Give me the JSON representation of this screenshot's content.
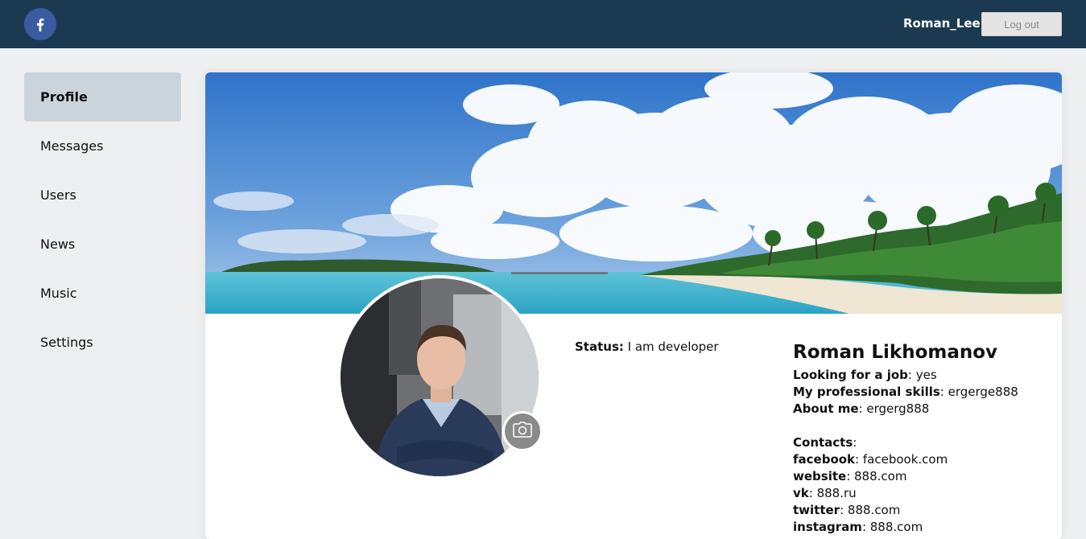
{
  "header": {
    "logo_icon": "facebook-icon",
    "username": "Roman_Lee",
    "logout_label": "Log out"
  },
  "sidebar": {
    "items": [
      {
        "label": "Profile",
        "active": true
      },
      {
        "label": "Messages",
        "active": false
      },
      {
        "label": "Users",
        "active": false
      },
      {
        "label": "News",
        "active": false
      },
      {
        "label": "Music",
        "active": false
      },
      {
        "label": "Settings",
        "active": false
      }
    ]
  },
  "profile": {
    "cover_image": "tropical-beach-cover",
    "avatar_image": "man-in-navy-suit",
    "camera_icon": "camera-icon",
    "status_label": "Status:",
    "status_value": "I am developer",
    "full_name": "Roman Likhomanov",
    "looking_for_job_label": "Looking for a job",
    "looking_for_job_value": ": yes",
    "skills_label": "My professional skills",
    "skills_value": ": ergerge888",
    "about_label": "About me",
    "about_value": ": ergerg888",
    "contacts_label": "Contacts",
    "contacts_colon": ":",
    "contacts": [
      {
        "label": "facebook",
        "value": ": facebook.com"
      },
      {
        "label": "website",
        "value": ": 888.com"
      },
      {
        "label": "vk",
        "value": ": 888.ru"
      },
      {
        "label": "twitter",
        "value": ": 888.com"
      },
      {
        "label": "instagram",
        "value": ": 888.com"
      }
    ]
  },
  "colors": {
    "header_bg": "#1b3a52",
    "active_nav_bg": "#cbd3db",
    "page_bg": "#eeeff1"
  }
}
